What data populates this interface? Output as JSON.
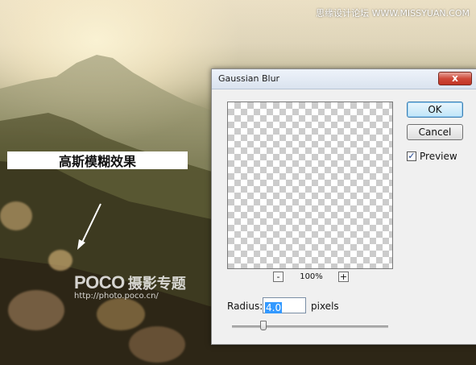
{
  "watermarks": {
    "site": "思缘设计论坛  WWW.MISSYUAN.COM",
    "poco_logo": "POCO",
    "poco_cn": "摄影专题",
    "poco_url": "http://photo.poco.cn/"
  },
  "caption": "高斯模糊效果",
  "dialog": {
    "title": "Gaussian Blur",
    "close_glyph": "x",
    "ok_label": "OK",
    "cancel_label": "Cancel",
    "preview_label": "Preview",
    "preview_checked": true,
    "check_glyph": "✓",
    "zoom_minus": "-",
    "zoom_plus": "+",
    "zoom_level": "100%",
    "radius_label": "Radius:",
    "radius_value": "4.0",
    "radius_units": "pixels",
    "radius_slider_fraction": 0.2
  },
  "colors": {
    "ok_border": "#3c7fb1",
    "close_button": "#c13424",
    "selection": "#3399ff"
  }
}
